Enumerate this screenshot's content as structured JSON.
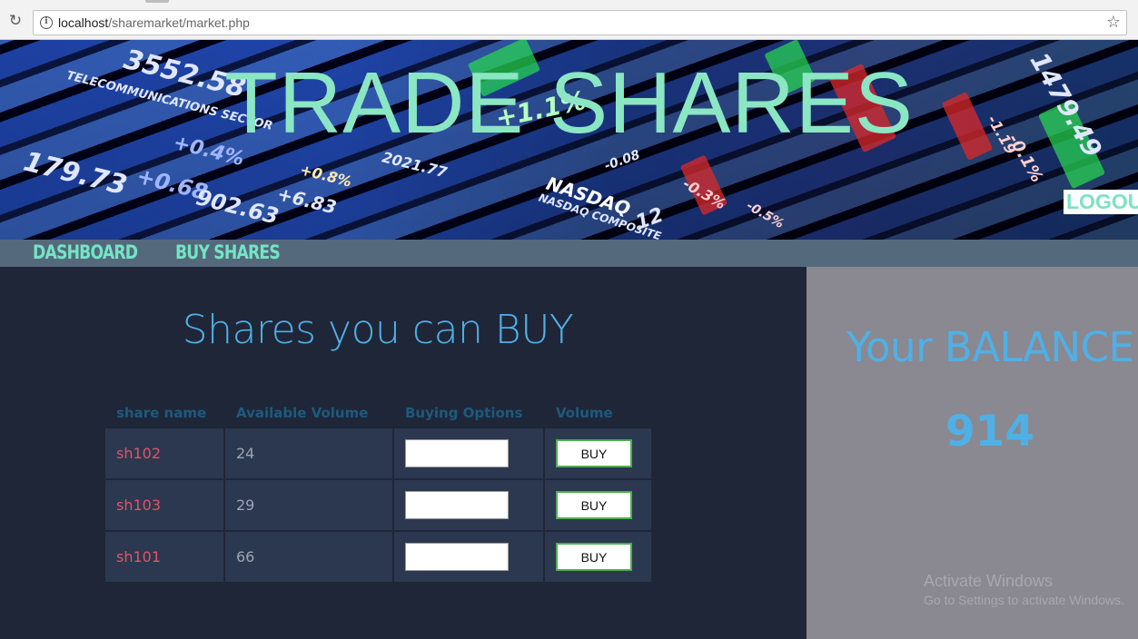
{
  "browser": {
    "url_host": "localhost",
    "url_path": "/sharemarket/market.php"
  },
  "banner": {
    "title": "TRADE SHARES",
    "logout_label": "LOGOUT",
    "tickers": [
      "3552.58",
      "TELECOMMUNICATIONS SECTOR",
      "+0.4%",
      "179.73",
      "+0.68",
      "902.63",
      "+6.83",
      "NASDAQ",
      "2021.77",
      "+0.8%",
      "NASDAQ COMPOSITE",
      "+1.1%",
      "1479.49",
      "-0.1%",
      "-1.19",
      "-0.3%",
      "-0.5%",
      "-0.08",
      "12"
    ]
  },
  "nav": {
    "items": [
      {
        "label": "DASHBOARD"
      },
      {
        "label": "BUY SHARES"
      }
    ]
  },
  "main": {
    "title": "Shares you can BUY",
    "columns": [
      "share name",
      "Available Volume",
      "Buying Options",
      "Volume"
    ],
    "rows": [
      {
        "name": "sh102",
        "volume": "24",
        "button": "BUY"
      },
      {
        "name": "sh103",
        "volume": "29",
        "button": "BUY"
      },
      {
        "name": "sh101",
        "volume": "66",
        "button": "BUY"
      }
    ]
  },
  "sidebar": {
    "title": "Your BALANCE",
    "balance": "914"
  },
  "watermark": {
    "line1": "Activate Windows",
    "line2": "Go to Settings to activate Windows."
  }
}
